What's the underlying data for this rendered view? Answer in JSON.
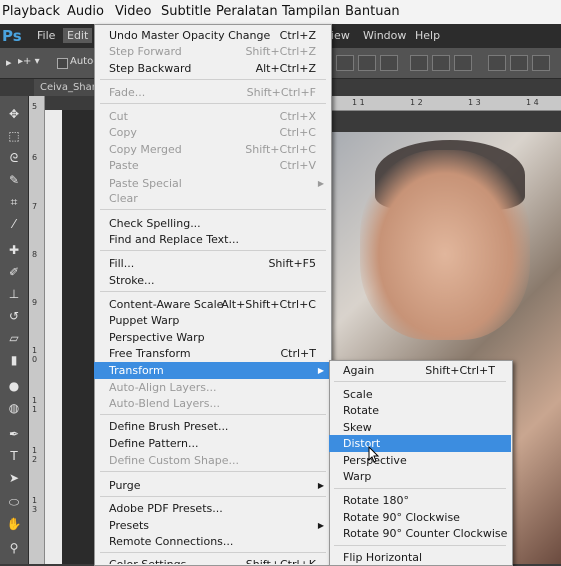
{
  "player_menu": [
    "Playback",
    "Audio",
    "Video",
    "Subtitle",
    "Peralatan",
    "Tampilan",
    "Bantuan"
  ],
  "ps": {
    "logo": "Ps",
    "menus": {
      "file": "File",
      "edit": "Edit",
      "view": "iew",
      "window": "Window",
      "help": "Help"
    },
    "options_text": "Auto-",
    "doc_tab": "Ceiva_Share"
  },
  "edit_menu": {
    "undo": {
      "label": "Undo Master Opacity Change",
      "shortcut": "Ctrl+Z"
    },
    "step_forward": {
      "label": "Step Forward",
      "shortcut": "Shift+Ctrl+Z"
    },
    "step_backward": {
      "label": "Step Backward",
      "shortcut": "Alt+Ctrl+Z"
    },
    "fade": {
      "label": "Fade...",
      "shortcut": "Shift+Ctrl+F"
    },
    "cut": {
      "label": "Cut",
      "shortcut": "Ctrl+X"
    },
    "copy": {
      "label": "Copy",
      "shortcut": "Ctrl+C"
    },
    "copy_merged": {
      "label": "Copy Merged",
      "shortcut": "Shift+Ctrl+C"
    },
    "paste": {
      "label": "Paste",
      "shortcut": "Ctrl+V"
    },
    "paste_special": {
      "label": "Paste Special"
    },
    "clear": {
      "label": "Clear"
    },
    "check_spelling": {
      "label": "Check Spelling..."
    },
    "find_replace": {
      "label": "Find and Replace Text..."
    },
    "fill": {
      "label": "Fill...",
      "shortcut": "Shift+F5"
    },
    "stroke": {
      "label": "Stroke..."
    },
    "content_aware_scale": {
      "label": "Content-Aware Scale",
      "shortcut": "Alt+Shift+Ctrl+C"
    },
    "puppet_warp": {
      "label": "Puppet Warp"
    },
    "perspective_warp": {
      "label": "Perspective Warp"
    },
    "free_transform": {
      "label": "Free Transform",
      "shortcut": "Ctrl+T"
    },
    "transform": {
      "label": "Transform"
    },
    "auto_align": {
      "label": "Auto-Align Layers..."
    },
    "auto_blend": {
      "label": "Auto-Blend Layers..."
    },
    "define_brush": {
      "label": "Define Brush Preset..."
    },
    "define_pattern": {
      "label": "Define Pattern..."
    },
    "define_shape": {
      "label": "Define Custom Shape..."
    },
    "purge": {
      "label": "Purge"
    },
    "pdf_presets": {
      "label": "Adobe PDF Presets..."
    },
    "presets": {
      "label": "Presets"
    },
    "remote_connections": {
      "label": "Remote Connections..."
    },
    "color_settings": {
      "label": "Color Settings...",
      "shortcut": "Shift+Ctrl+K"
    }
  },
  "transform_menu": {
    "again": {
      "label": "Again",
      "shortcut": "Shift+Ctrl+T"
    },
    "scale": "Scale",
    "rotate": "Rotate",
    "skew": "Skew",
    "distort": "Distort",
    "perspective": "Perspective",
    "warp": "Warp",
    "rotate_180": "Rotate 180°",
    "rotate_90_cw": "Rotate 90° Clockwise",
    "rotate_90_ccw": "Rotate 90° Counter Clockwise",
    "flip_horizontal": "Flip Horizontal"
  },
  "ruler": {
    "v_numbers": [
      "5",
      "6",
      "7",
      "8",
      "9",
      "1 0",
      "1 1",
      "1 2",
      "1 3"
    ],
    "h_numbers": [
      "1 1",
      "1 2",
      "1 3",
      "1 4"
    ]
  },
  "colors": {
    "highlight": "#3c8de0",
    "menu_bg": "#f0f0f0",
    "ps_dark": "#2c2c2c",
    "ps_panel": "#535353"
  }
}
